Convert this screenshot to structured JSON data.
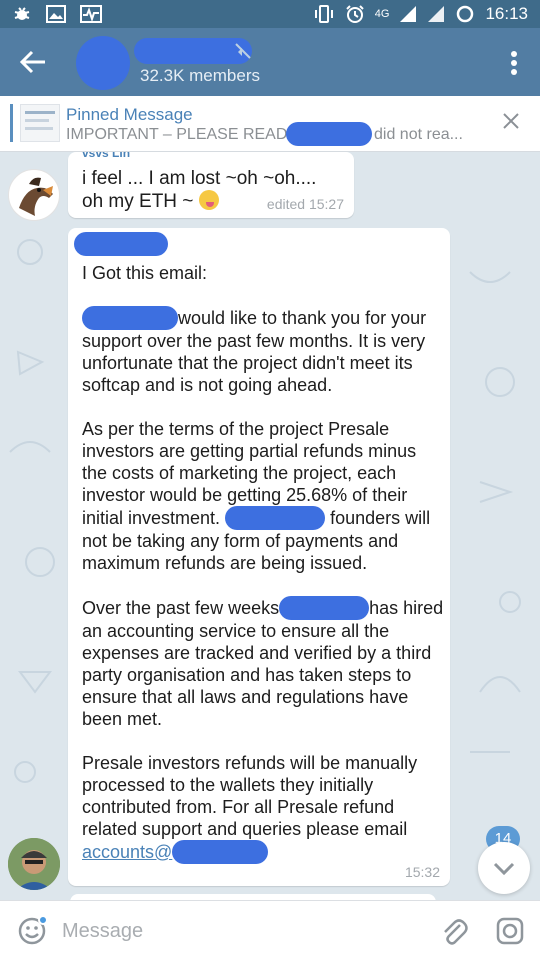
{
  "status_bar": {
    "network": "4G",
    "time": "16:13",
    "icons": [
      "bug-icon",
      "image-icon",
      "activity-icon",
      "vibrate-icon",
      "alarm-icon",
      "signal-icon",
      "signal-r-icon",
      "battery-icon"
    ]
  },
  "header": {
    "members": "32.3K members",
    "icons": [
      "back-arrow-icon",
      "mute-icon",
      "more-vert-icon"
    ]
  },
  "pinned": {
    "title": "Pinned Message",
    "text": "IMPORTANT – PLEASE READ!",
    "text_tail": "did not rea..."
  },
  "messages": [
    {
      "sender_cut": "vsvs Lin",
      "text": "i feel ... I am lost ~oh ~oh.... oh my ETH ~",
      "time": "edited 15:27"
    },
    {
      "greeting": "I Got this email:",
      "p1": "would like to thank you for your support over the past few months. It is very unfortunate that the project didn't meet its softcap and is not going ahead.",
      "p2a": "As per the terms of the project Presale investors are getting partial refunds minus the costs of marketing the project, each investor would be getting 25.68% of their initial investment.",
      "p2b": "founders will not be taking any form of payments and maximum refunds are being issued.",
      "p3a": "Over the past few weeks",
      "p3b": "has hired an accounting service to ensure all the expenses are tracked and verified by a third party organisation and has taken steps to ensure that all laws and regulations have been met.",
      "p4": "Presale investors refunds will be manually processed to the wallets they initially contributed from. For all Presale refund related support and queries please email",
      "email_prefix": "accounts@",
      "time": "15:32"
    }
  ],
  "unread_count": "14",
  "input": {
    "placeholder": "Message"
  },
  "colors": {
    "toolbar": "#527da3",
    "status_bar": "#3f6b8a",
    "accent": "#4a82b7",
    "redaction": "#3d6fe0",
    "badge": "#5c9bd5"
  }
}
